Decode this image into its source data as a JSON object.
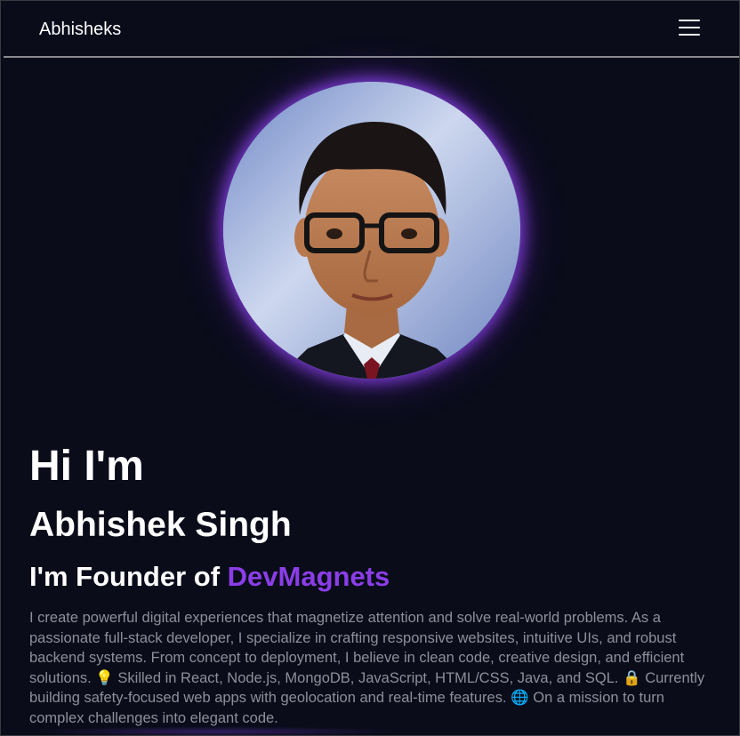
{
  "navbar": {
    "brand": "Abhisheks",
    "menu_icon": "hamburger-menu-icon"
  },
  "hero": {
    "greeting": "Hi I'm",
    "name": "Abhishek Singh",
    "founder_prefix": "I'm Founder of ",
    "company": "DevMagnets",
    "bio": "I create powerful digital experiences that magnetize attention and solve real-world problems. As a passionate full-stack developer, I specialize in crafting responsive websites, intuitive UIs, and robust backend systems. From concept to deployment, I believe in clean code, creative design, and efficient solutions. 💡 Skilled in React, Node.js, MongoDB, JavaScript, HTML/CSS, Java, and SQL. 🔒 Currently building safety-focused web apps with geolocation and real-time features. 🌐 On a mission to turn complex challenges into elegant code."
  },
  "colors": {
    "background": "#0a0c1a",
    "accent": "#8b3ee8",
    "text": "#ffffff",
    "muted_text": "#8d8f98"
  }
}
